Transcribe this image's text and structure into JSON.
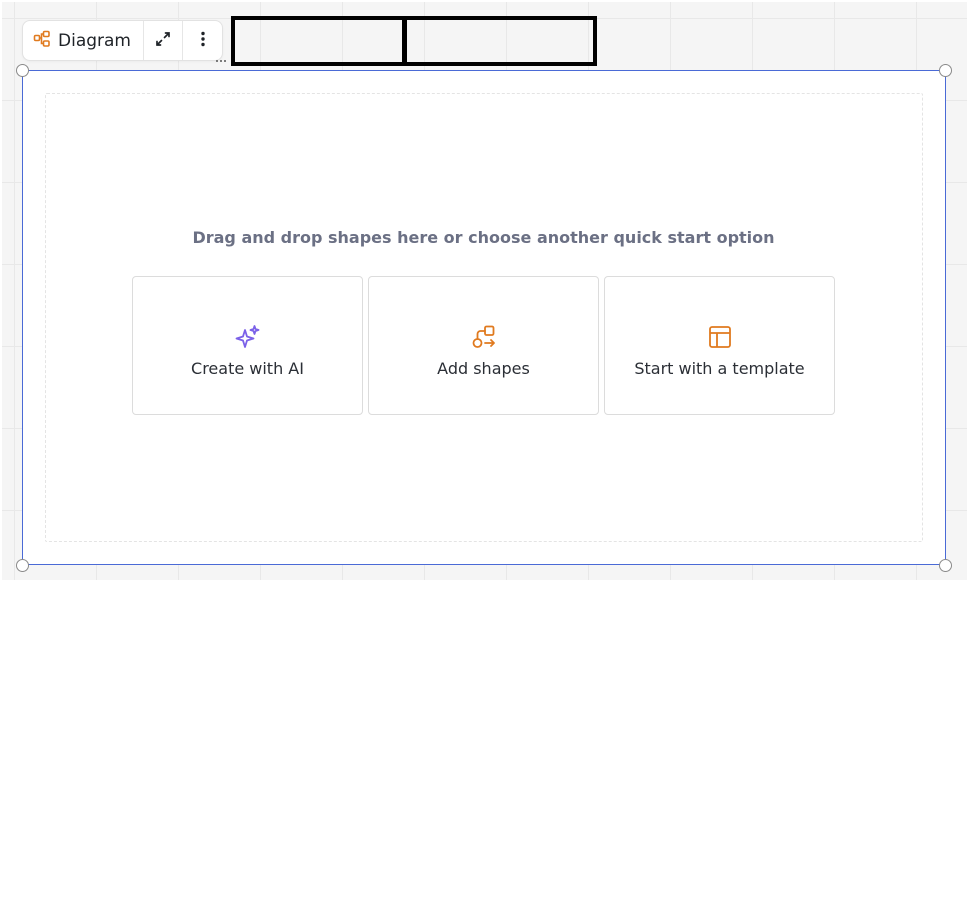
{
  "toolbar": {
    "label": "Diagram",
    "icons": {
      "type": "diagram-icon",
      "expand": "expand-icon",
      "more": "more-vertical-icon"
    }
  },
  "canvas": {
    "hint": "Drag and drop shapes here or choose another quick start option",
    "cards": [
      {
        "label": "Create with AI",
        "icon": "sparkle-icon",
        "color": "#7b61e8"
      },
      {
        "label": "Add shapes",
        "icon": "shapes-icon",
        "color": "#e07a1f"
      },
      {
        "label": "Start with a template",
        "icon": "template-icon",
        "color": "#e07a1f"
      }
    ]
  },
  "colors": {
    "accent": "#4a6ad6",
    "ai": "#7b61e8",
    "orange": "#e07a1f"
  }
}
